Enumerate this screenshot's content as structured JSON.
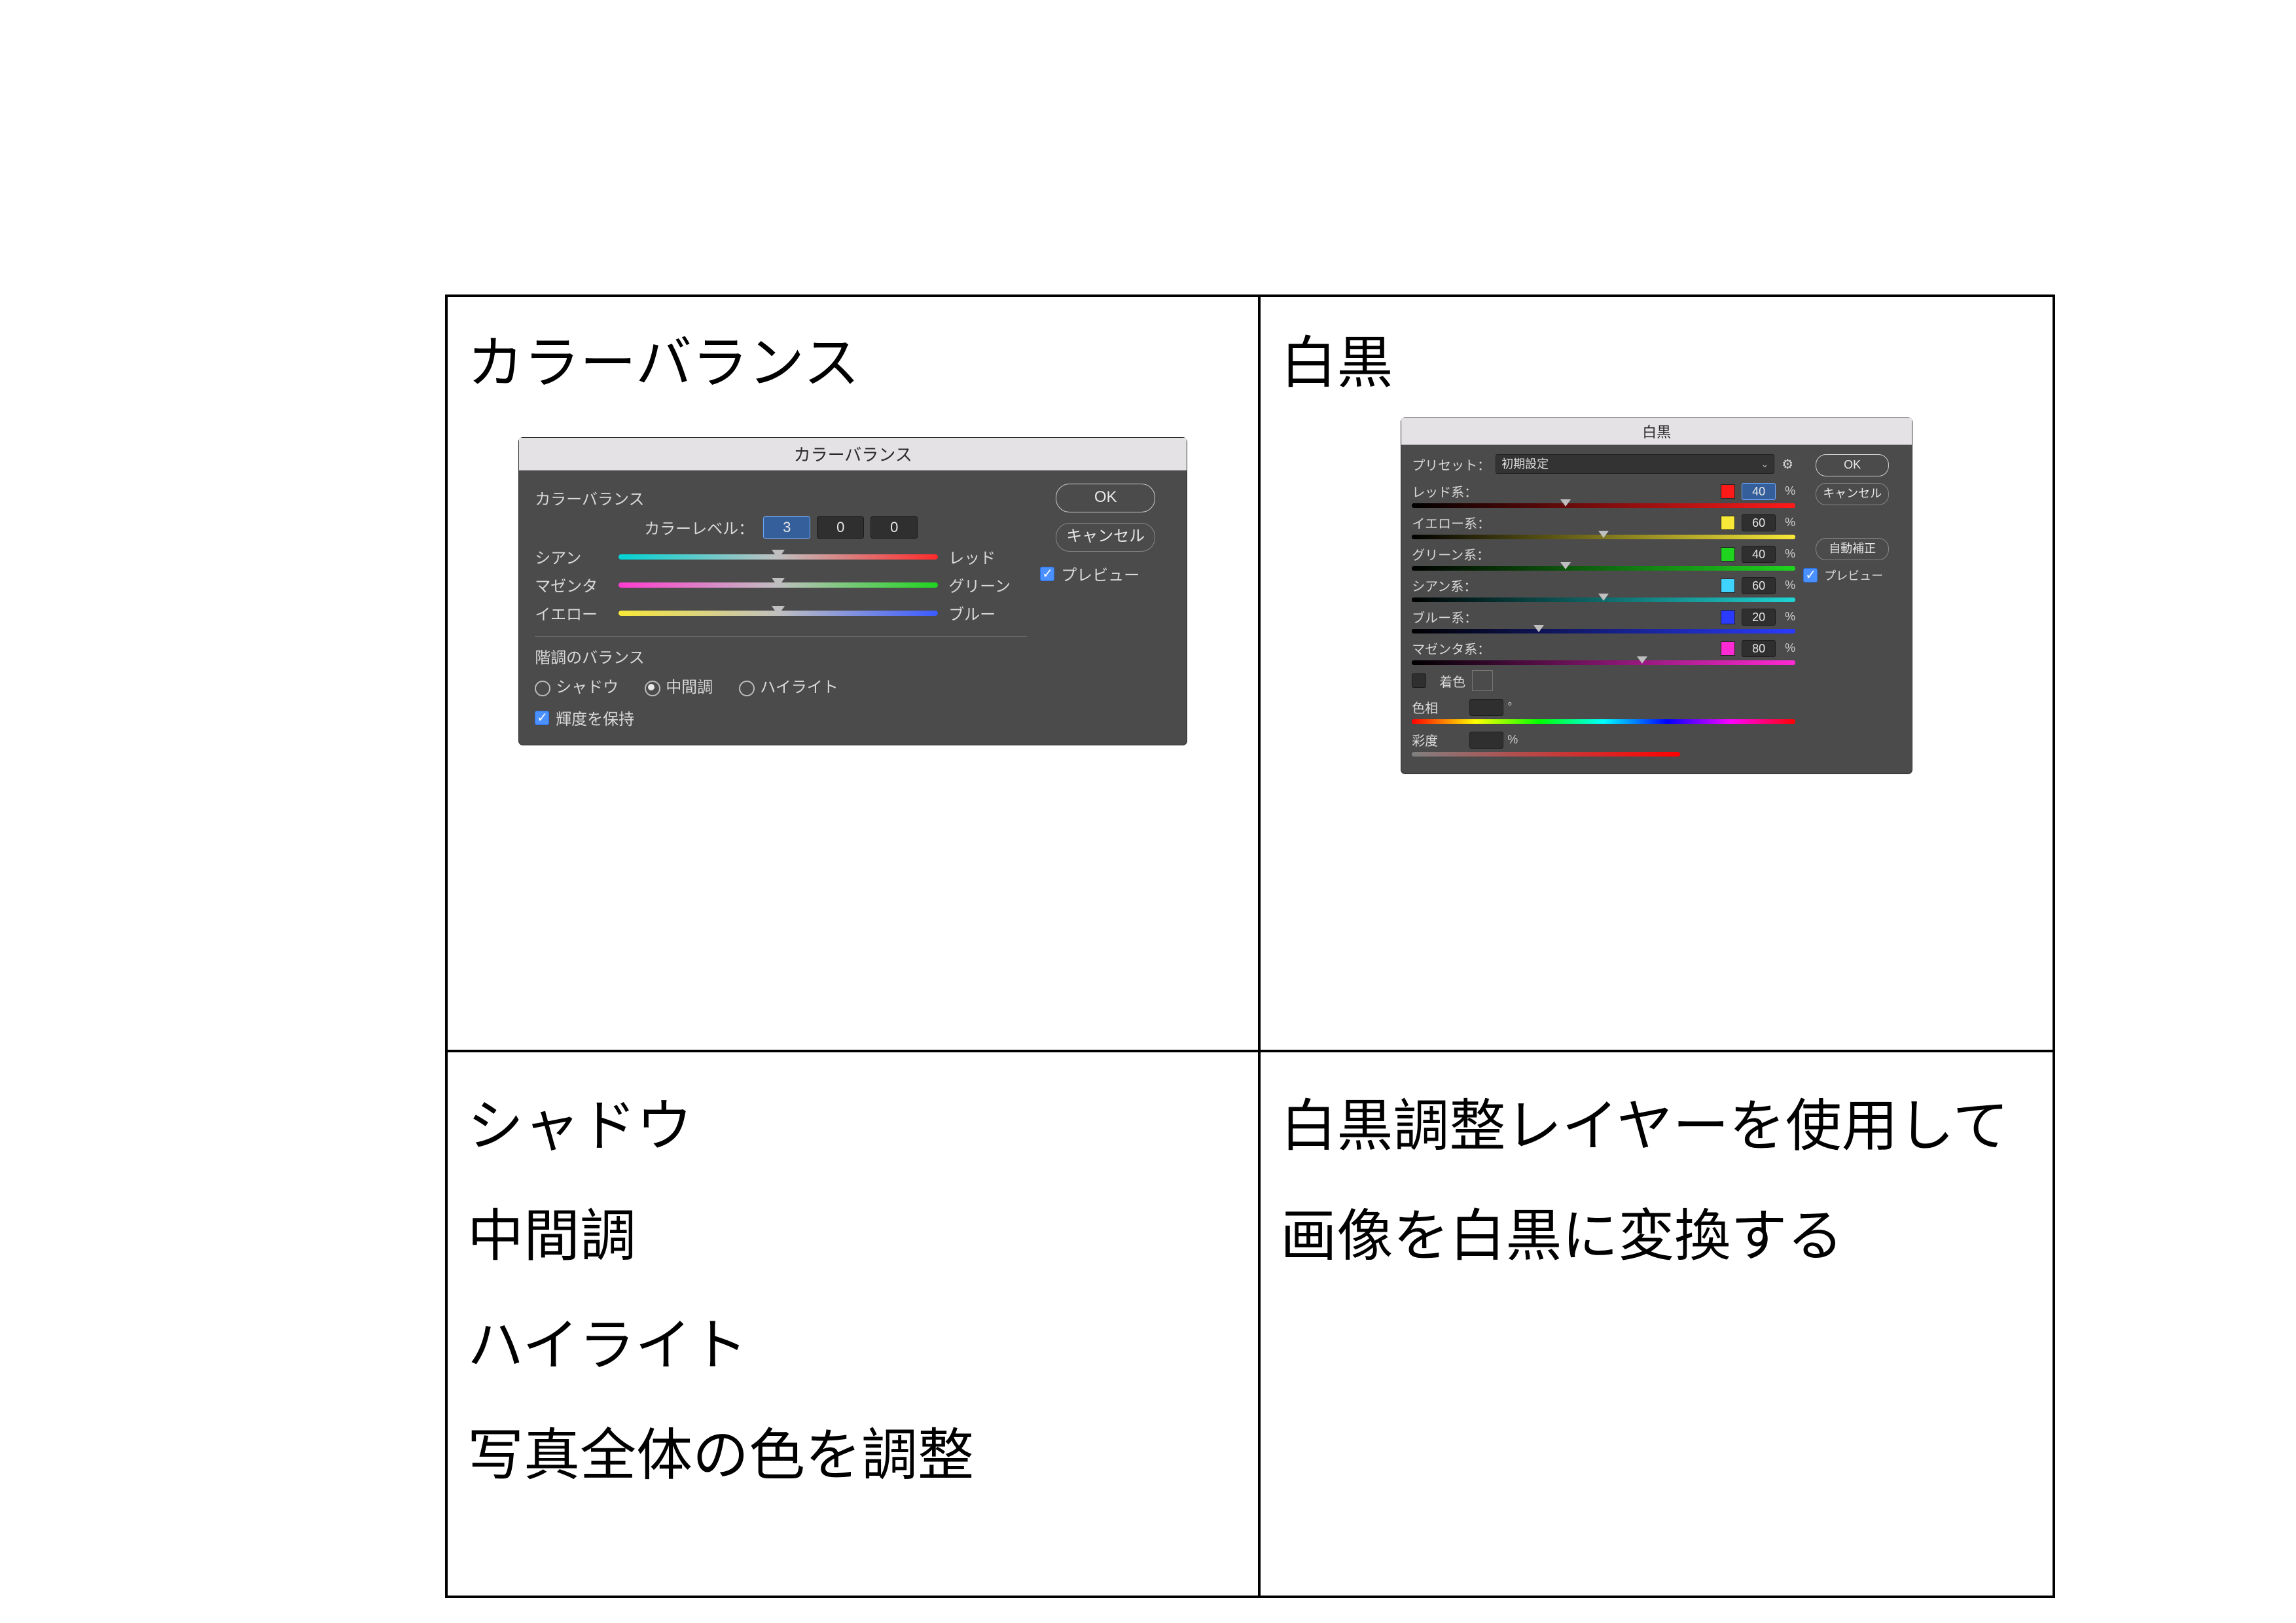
{
  "cells": {
    "tl_title": "カラーバランス",
    "tr_title": "白黒",
    "bl_text": "シャドウ\n中間調\nハイライト\n写真全体の色を調整",
    "br_text": "白黒調整レイヤーを使用して画像を白黒に変換する"
  },
  "color_balance_dialog": {
    "title": "カラーバランス",
    "section_label": "カラーバランス",
    "levels_label": "カラーレベル：",
    "levels": {
      "v1": "3",
      "v2": "0",
      "v3": "0"
    },
    "sliders": {
      "cyan_label": "シアン",
      "red_label": "レッド",
      "magenta_label": "マゼンタ",
      "green_label": "グリーン",
      "yellow_label": "イエロー",
      "blue_label": "ブルー"
    },
    "tone_section_label": "階調のバランス",
    "tone": {
      "shadows_label": "シャドウ",
      "midtones_label": "中間調",
      "highlights_label": "ハイライト",
      "selected": "midtones"
    },
    "preserve_luminosity_label": "輝度を保持",
    "preserve_luminosity_checked": true,
    "ok_label": "OK",
    "cancel_label": "キャンセル",
    "preview_label": "プレビュー",
    "preview_checked": true
  },
  "bw_dialog": {
    "title": "白黒",
    "preset_label": "プリセット：",
    "preset_value": "初期設定",
    "ok_label": "OK",
    "cancel_label": "キャンセル",
    "auto_label": "自動補正",
    "preview_label": "プレビュー",
    "preview_checked": true,
    "percent_sign": "%",
    "degree_sign": "°",
    "channels": [
      {
        "label": "レッド系：",
        "class": "red",
        "value": "40",
        "pos": 40,
        "selected": true
      },
      {
        "label": "イエロー系：",
        "class": "yellow",
        "value": "60",
        "pos": 50,
        "selected": false
      },
      {
        "label": "グリーン系：",
        "class": "green",
        "value": "40",
        "pos": 40,
        "selected": false
      },
      {
        "label": "シアン系：",
        "class": "cyan",
        "value": "60",
        "pos": 50,
        "selected": false
      },
      {
        "label": "ブルー系：",
        "class": "blue",
        "value": "20",
        "pos": 33,
        "selected": false
      },
      {
        "label": "マゼンタ系：",
        "class": "magenta",
        "value": "80",
        "pos": 60,
        "selected": false
      }
    ],
    "tint_label": "着色",
    "tint_checked": false,
    "hue_label": "色相",
    "sat_label": "彩度"
  }
}
